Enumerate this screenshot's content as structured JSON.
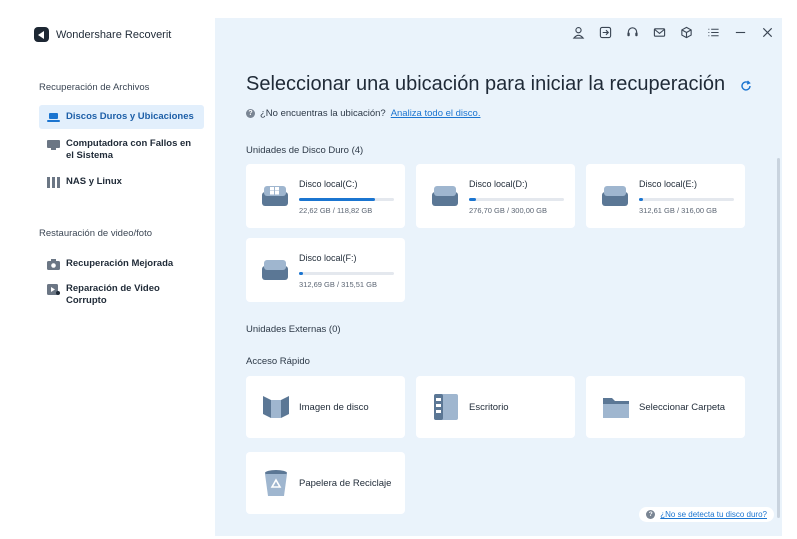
{
  "app": {
    "title": "Wondershare Recoverit"
  },
  "sidebar": {
    "sections": [
      {
        "title": "Recuperación de Archivos"
      },
      {
        "title": "Restauración de video/foto"
      }
    ],
    "items": [
      {
        "label": "Discos Duros y Ubicaciones",
        "active": true
      },
      {
        "label": "Computadora con Fallos en el Sistema",
        "active": false
      },
      {
        "label": "NAS y Linux",
        "active": false
      },
      {
        "label": "Recuperación Mejorada",
        "active": false
      },
      {
        "label": "Reparación de Video Corrupto",
        "active": false
      }
    ]
  },
  "main": {
    "title": "Seleccionar una ubicación para iniciar la recuperación",
    "hint_text": "¿No encuentras la ubicación?",
    "hint_link": "Analiza todo el disco.",
    "hard_drives_title": "Unidades de Disco Duro (4)",
    "drives": [
      {
        "name": "Disco local(C:)",
        "size": "22,62 GB / 118,82 GB",
        "fill_fraction": 0.8
      },
      {
        "name": "Disco local(D:)",
        "size": "276,70 GB / 300,00 GB",
        "fill_fraction": 0.07
      },
      {
        "name": "Disco local(E:)",
        "size": "312,61 GB / 316,00 GB",
        "fill_fraction": 0.04
      },
      {
        "name": "Disco local(F:)",
        "size": "312,69 GB / 315,51 GB",
        "fill_fraction": 0.04
      }
    ],
    "external_title": "Unidades Externas (0)",
    "quick_title": "Acceso Rápido",
    "quick": [
      {
        "label": "Imagen de disco"
      },
      {
        "label": "Escritorio"
      },
      {
        "label": "Seleccionar Carpeta"
      },
      {
        "label": "Papelera de Reciclaje"
      }
    ],
    "help_link": "¿No se detecta tu disco duro?"
  },
  "colors": {
    "accent": "#1b75d0",
    "main_bg": "#eaf3fb",
    "active_item_bg": "#e2effc"
  }
}
